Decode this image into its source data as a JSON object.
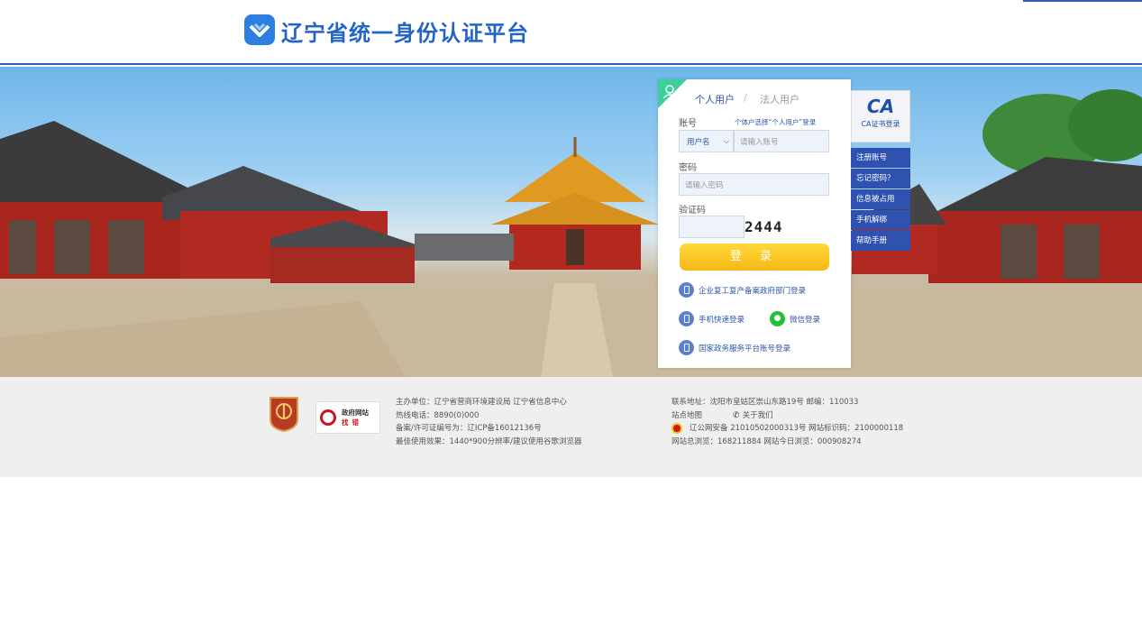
{
  "header": {
    "title": "辽宁省统一身份认证平台"
  },
  "login": {
    "tabs": [
      {
        "label": "个人用户",
        "active": true
      },
      {
        "label": "法人用户",
        "active": false
      }
    ],
    "tab_separator": "/",
    "account_label": "账号",
    "account_hint": "个体户选择“个人用户”登录",
    "account_type": "用户名",
    "account_placeholder": "请输入账号",
    "password_label": "密码",
    "password_placeholder": "请输入密码",
    "captcha_label": "验证码",
    "captcha_text": "2444",
    "login_button": "登 录",
    "alt_logins": {
      "enterprise": "企业复工复产备案政府部门登录",
      "phone": "手机快速登录",
      "wechat": "微信登录",
      "national": "国家政务服务平台账号登录"
    }
  },
  "side_menu": {
    "ca_mark": "CA",
    "ca_label": "CA证书登录",
    "items": [
      "注册账号",
      "忘记密码？",
      "信息被占用",
      "手机解绑",
      "帮助手册"
    ]
  },
  "footer": {
    "gov_badge_line1": "政府网站",
    "gov_badge_line2": "找错",
    "left": [
      "主办单位：辽宁省营商环境建设局   辽宁省信息中心",
      "热线电话：8890(0)000",
      "备案/许可证编号为：辽ICP备16012136号",
      "最佳使用效果：1440*900分辨率/建议使用谷歌浏览器"
    ],
    "address": "联系地址：沈阳市皇姑区崇山东路19号   邮编：110033",
    "sitemap": "站点地图",
    "about": "关于我们",
    "police": "辽公网安备 21010502000313号 网站标识码：2100000118",
    "stats": "网站总浏览：168211884    网站今日浏览：000908274"
  },
  "colors": {
    "brand_blue": "#2464c8",
    "menu_blue": "#2f52b0",
    "login_yellow": "#f7b816"
  }
}
